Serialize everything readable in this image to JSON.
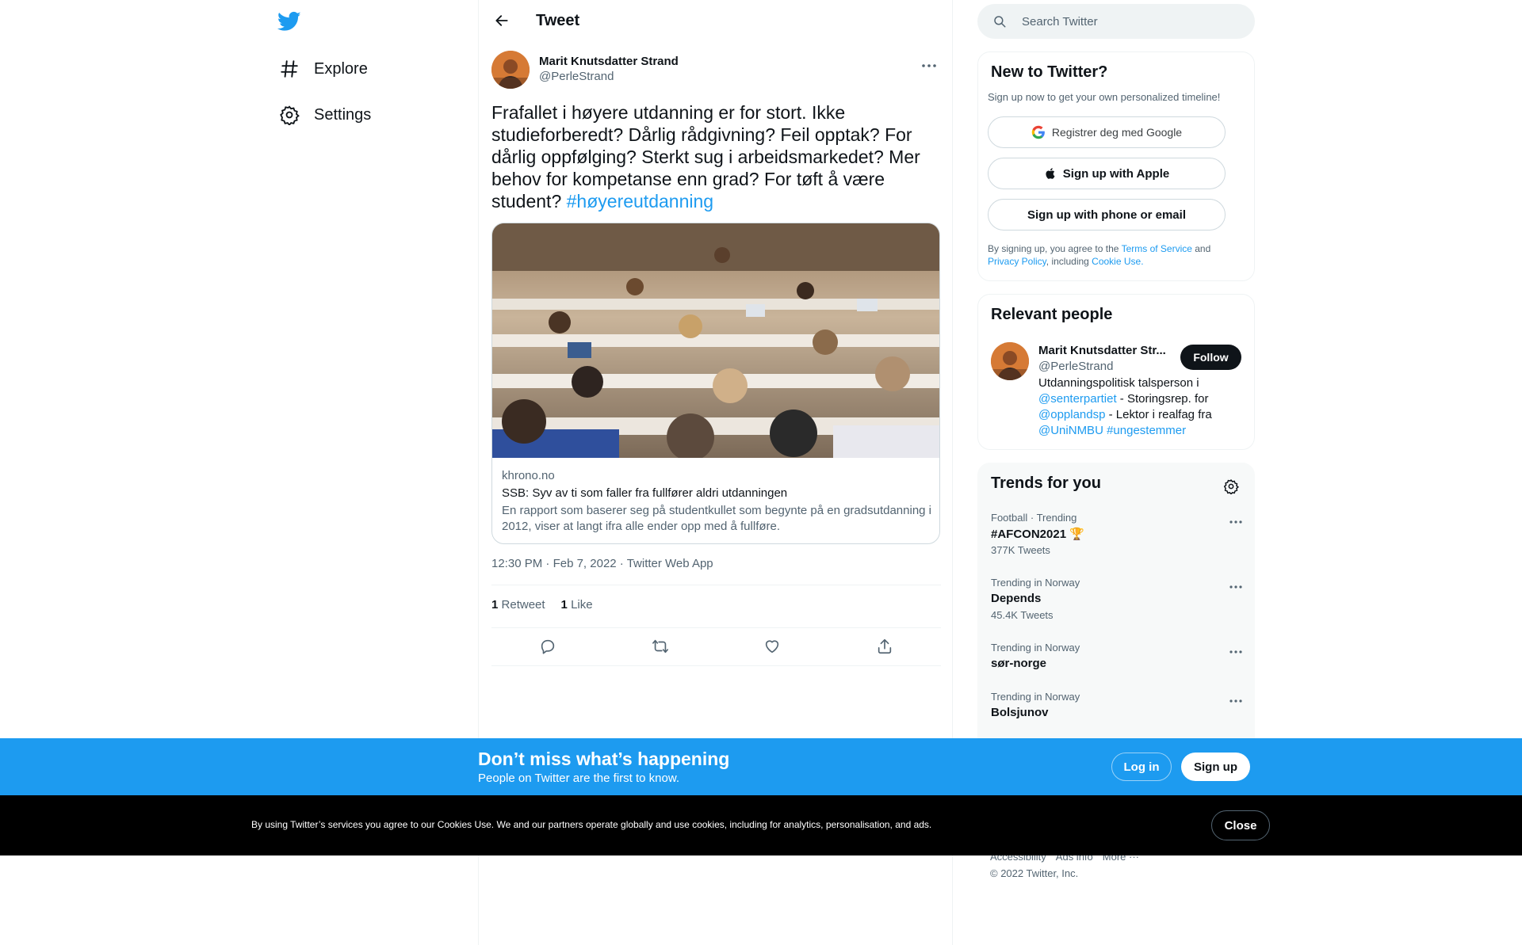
{
  "nav": {
    "logo": "twitter-bird-icon",
    "items": [
      {
        "label": "Explore",
        "icon": "hashtag-icon"
      },
      {
        "label": "Settings",
        "icon": "gear-icon"
      }
    ]
  },
  "header": {
    "title": "Tweet"
  },
  "tweet": {
    "author_name": "Marit Knutsdatter Strand",
    "author_handle": "@PerleStrand",
    "text": "Frafallet i høyere utdanning er for stort. Ikke studieforberedt? Dårlig rådgivning? Feil opptak? For dårlig oppfølging? Sterkt sug i arbeidsmarkedet? Mer behov for kompetanse enn grad? For tøft å være student? ",
    "hashtag": "#høyereutdanning",
    "card": {
      "domain": "khrono.no",
      "title": "SSB: Syv av ti som faller fra fullfører aldri utdanningen",
      "description": "En rapport som baserer seg på studentkullet som begynte på en gradsutdanning i 2012, viser at langt ifra alle ender opp med å fullføre."
    },
    "time": "12:30 PM",
    "date": "Feb 7, 2022",
    "source": "Twitter Web App",
    "retweets_count": "1",
    "retweets_label": "Retweet",
    "likes_count": "1",
    "likes_label": "Like"
  },
  "search": {
    "placeholder": "Search Twitter"
  },
  "signup": {
    "title": "New to Twitter?",
    "subtitle": "Sign up now to get your own personalized timeline!",
    "google": "Registrer deg med Google",
    "apple": "Sign up with Apple",
    "phone": "Sign up with phone or email",
    "terms_prefix": "By signing up, you agree to the ",
    "terms_link": "Terms of Service",
    "terms_and": " and ",
    "privacy_link": "Privacy Policy",
    "terms_including": ", including ",
    "cookie_link": "Cookie Use."
  },
  "relevant": {
    "title": "Relevant people",
    "name": "Marit Knutsdatter Str...",
    "handle": "@PerleStrand",
    "follow": "Follow",
    "bio_1": "Utdanningspolitisk talsperson i ",
    "bio_link_1": "@senterpartiet",
    "bio_2": " - Storingsrep. for ",
    "bio_link_2": "@opplandsp",
    "bio_3": " - Lektor i realfag fra ",
    "bio_link_3": "@UniNMBU",
    "bio_4": " ",
    "bio_link_4": "#ungestemmer"
  },
  "trends": {
    "title": "Trends for you",
    "items": [
      {
        "context": "Football · Trending",
        "name": "#AFCON2021 🏆",
        "count": "377K Tweets"
      },
      {
        "context": "Trending in Norway",
        "name": "Depends",
        "count": "45.4K Tweets"
      },
      {
        "context": "Trending in Norway",
        "name": "sør-norge",
        "count": ""
      },
      {
        "context": "Trending in Norway",
        "name": "Bolsjunov",
        "count": ""
      }
    ]
  },
  "footer": {
    "links": [
      "Accessibility",
      "Ads info",
      "More ···"
    ],
    "copyright": "© 2022 Twitter, Inc."
  },
  "banner": {
    "headline": "Don’t miss what’s happening",
    "subline": "People on Twitter are the first to know.",
    "login": "Log in",
    "signup": "Sign up"
  },
  "cookies": {
    "text": "By using Twitter’s services you agree to our Cookies Use. We and our partners operate globally and use cookies, including for analytics, personalisation, and ads.",
    "close": "Close"
  },
  "colors": {
    "accent": "#1d9bf0",
    "text": "#0f1419",
    "muted": "#536471",
    "cookie_bg": "#000000"
  }
}
